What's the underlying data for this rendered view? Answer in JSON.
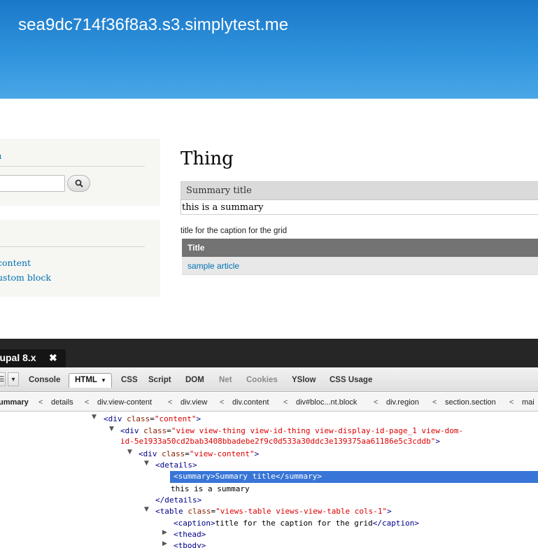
{
  "site": {
    "name": "sea9dc714f36f8a3.s3.simplytest.me"
  },
  "sidebar": {
    "search_block": {
      "heading": "h",
      "button_icon": "magnifier-icon"
    },
    "tools_block": {
      "links": [
        "content",
        "ustom block"
      ]
    }
  },
  "main": {
    "title": "Thing",
    "details": {
      "summary": "Summary title",
      "body": "this is a summary"
    },
    "grid": {
      "caption": "title for the caption for the grid",
      "header": "Title",
      "rows": [
        "sample article"
      ]
    }
  },
  "firebug": {
    "tab_title": "rupal 8.x",
    "close_icon": "close-icon",
    "tabs": [
      "Console",
      "HTML",
      "CSS",
      "Script",
      "DOM",
      "Net",
      "Cookies",
      "YSlow",
      "CSS Usage"
    ],
    "breadcrumbs": [
      "ummary",
      "details",
      "div.view-content",
      "div.view",
      "div.content",
      "div#bloc...nt.block",
      "div.region",
      "section.section",
      "mai"
    ],
    "tree": {
      "l1_tag": "div",
      "l1_attr": "class",
      "l1_val": "\"content\"",
      "l2_tag": "div",
      "l2_attr": "class",
      "l2_val_a": "\"view view-thing view-id-thing view-display-id-page_1 view-dom-",
      "l2_val_b": "id-5e1933a50cd2bab3408bbadebe2f9c0d533a30ddc3e139375aa61186e5c3cddb\"",
      "l3_tag": "div",
      "l3_attr": "class",
      "l3_val": "\"view-content\"",
      "l4_tag": "details",
      "l5_open": "summary",
      "l5_text": "Summary title",
      "l5_close": "summary",
      "l6_text": "this is a summary",
      "l7_close": "details",
      "l8_tag": "table",
      "l8_attr": "class",
      "l8_val": "\"views-table views-view-table cols-1\"",
      "l9_open": "caption",
      "l9_text": "title for the caption for the grid",
      "l9_close": "caption",
      "l10_tag": "thead",
      "l11_tag": "tbody"
    }
  }
}
